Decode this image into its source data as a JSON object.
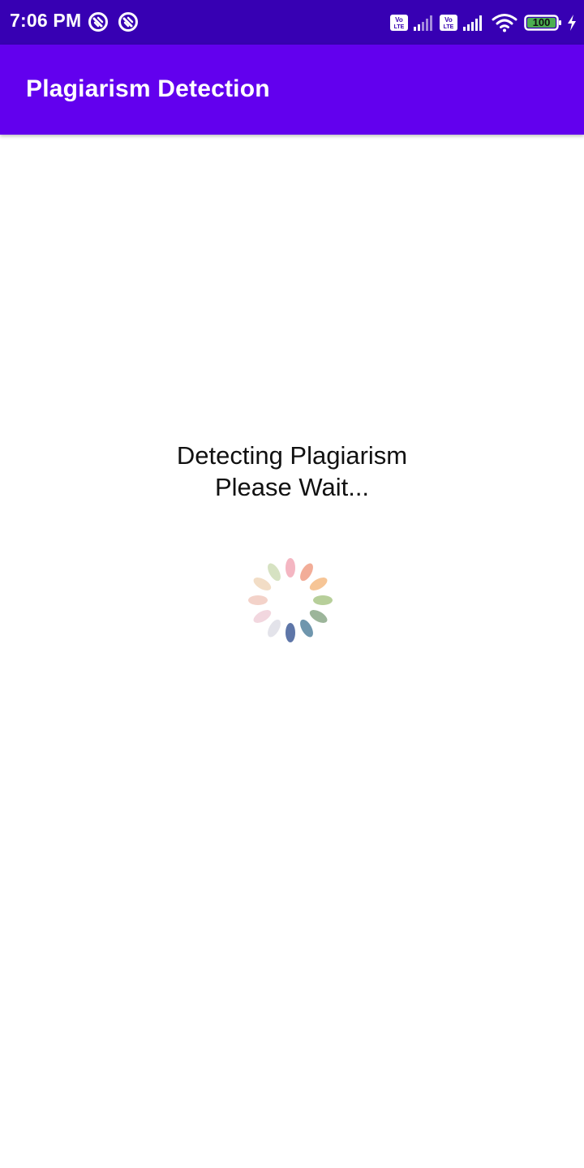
{
  "status_bar": {
    "time": "7:06 PM",
    "left_icons": [
      "app-notification-icon",
      "app-notification-icon"
    ],
    "right_icons": [
      "volte-icon",
      "signal-icon",
      "volte-icon",
      "signal-icon",
      "wifi-icon",
      "battery-icon",
      "charging-icon"
    ],
    "battery_level": "100"
  },
  "app_bar": {
    "title": "Plagiarism Detection"
  },
  "main": {
    "message_line1": "Detecting Plagiarism",
    "message_line2": "Please Wait..."
  },
  "colors": {
    "status_bar": "#3700b3",
    "app_bar": "#6200ee",
    "spinner_petals": [
      "#f4b6c2",
      "#f2ad98",
      "#f6c596",
      "#b7cf9a",
      "#9cb59a",
      "#6f96ad",
      "#5e76a8",
      "#e3e3ea",
      "#f2d7df",
      "#f3d2c9",
      "#f2ddc6",
      "#d6e2c2"
    ]
  },
  "spinner": {
    "type": "loading-spinner"
  }
}
